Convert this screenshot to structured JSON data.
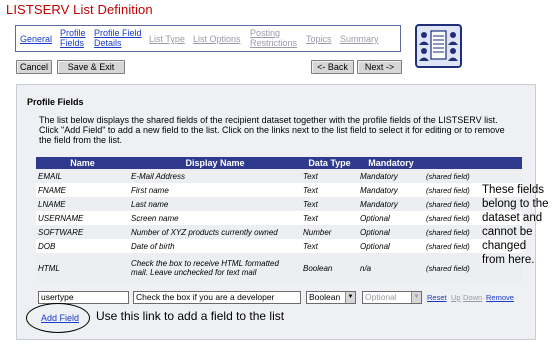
{
  "page_title": "LISTSERV List Definition",
  "wizard_tabs": [
    {
      "line1": "General",
      "line2": "",
      "state": "done"
    },
    {
      "line1": "Profile",
      "line2": "Fields",
      "state": "current"
    },
    {
      "line1": "Profile Field",
      "line2": "Details",
      "state": "done"
    },
    {
      "line1": "List Type",
      "line2": "",
      "state": "disabled"
    },
    {
      "line1": "List Options",
      "line2": "",
      "state": "disabled"
    },
    {
      "line1": "Posting",
      "line2": "Restrictions",
      "state": "disabled"
    },
    {
      "line1": "Topics",
      "line2": "",
      "state": "disabled"
    },
    {
      "line1": "Summary",
      "line2": "",
      "state": "disabled"
    }
  ],
  "wizard_logo_icon": "list-people-icon",
  "buttons": {
    "cancel": "Cancel",
    "save_exit": "Save & Exit",
    "back": "<- Back",
    "next": "Next ->"
  },
  "panel": {
    "heading": "Profile Fields",
    "description_lines": [
      "The list below displays the shared fields of the recipient dataset together with the profile fields of the LISTSERV list.",
      "Click \"Add Field\" to add a new field to the list. Click on the links next to the list field to select it for editing or to remove",
      "the field from the list."
    ]
  },
  "table": {
    "headers": [
      "Name",
      "Display Name",
      "Data Type",
      "Mandatory",
      ""
    ],
    "rows": [
      {
        "name": "EMAIL",
        "display": "E-Mail Address",
        "type": "Text",
        "mandatory": "Mandatory",
        "note": "(shared field)"
      },
      {
        "name": "FNAME",
        "display": "First name",
        "type": "Text",
        "mandatory": "Mandatory",
        "note": "(shared field)"
      },
      {
        "name": "LNAME",
        "display": "Last name",
        "type": "Text",
        "mandatory": "Mandatory",
        "note": "(shared field)"
      },
      {
        "name": "USERNAME",
        "display": "Screen name",
        "type": "Text",
        "mandatory": "Optional",
        "note": "(shared field)"
      },
      {
        "name": "SOFTWARE",
        "display": "Number of XYZ products currently owned",
        "type": "Number",
        "mandatory": "Optional",
        "note": "(shared field)"
      },
      {
        "name": "DOB",
        "display": "Date of birth",
        "type": "Text",
        "mandatory": "Optional",
        "note": "(shared field)"
      },
      {
        "name": "HTML",
        "display_line1": "Check the box to receive HTML formatted",
        "display_line2": "mail. Leave unchecked for text mail",
        "type": "Boolean",
        "mandatory": "n/a",
        "note": "(shared field)"
      }
    ]
  },
  "edit_row": {
    "name_value": "usertype",
    "display_value": "Check the box if you are a developer",
    "type_value": "Boolean",
    "mandatory_value": "Optional",
    "links": {
      "reset": "Reset",
      "up": "Up",
      "down": "Down",
      "remove": "Remove"
    }
  },
  "add_field_link": "Add Field",
  "callout_text": "Use this link to add a field to the list",
  "side_note_lines": [
    "These fields",
    "belong to the",
    "dataset and",
    "cannot be",
    "changed",
    "from here."
  ],
  "colors": {
    "title": "#c00000",
    "table_header": "#2f3a8e",
    "link": "#1a3cc8",
    "disabled_link": "#9a9aa8",
    "panel_bg": "#eef0f4"
  }
}
